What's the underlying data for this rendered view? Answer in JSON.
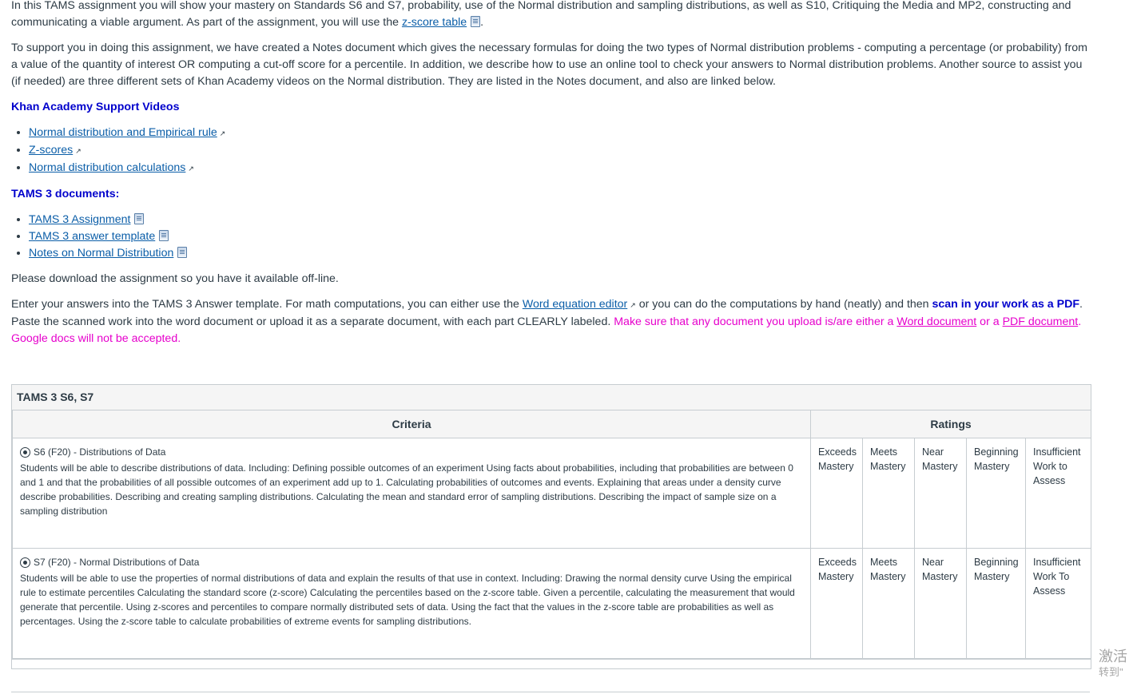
{
  "intro": {
    "p1_pre": "In this TAMS assignment you will show your mastery on Standards S6 and S7, probability, use of the Normal distribution and sampling distributions, as well as S10, Critiquing the Media and MP2, constructing and communicating a viable argument. As part of the assignment, you will use the ",
    "p1_link": "z-score table",
    "p1_post": ".",
    "p2": "To support you in doing this assignment, we have created a Notes document which gives the necessary formulas for doing the two types of Normal distribution problems - computing a percentage (or probability) from a value of the quantity of interest OR computing a cut-off score for a percentile. In addition, we describe how to use an online tool to check your answers to Normal distribution problems. Another source to assist you (if needed) are three different sets of Khan Academy videos on the Normal distribution. They are listed in the Notes document, and also are linked below."
  },
  "khan": {
    "heading": "Khan Academy Support Videos",
    "items": [
      "Normal distribution and Empirical rule",
      "Z-scores",
      "Normal distribution calculations"
    ]
  },
  "tams": {
    "heading": "TAMS 3 documents:",
    "items": [
      "TAMS 3 Assignment",
      "TAMS 3 answer template",
      "Notes on Normal Distribution"
    ]
  },
  "download_note": "Please download the assignment so you have it available off-line.",
  "answers": {
    "pre": "Enter your answers into the TAMS 3 Answer template. For math computations, you can either use the ",
    "editor_link": "Word equation editor",
    "mid": " or you can do the computations by hand (neatly) and then ",
    "scan": "scan in your work as a PDF",
    "post": ". Paste the scanned work  into the word document or upload it as a separate document, with each part CLEARLY labeled. ",
    "warn_pre": "Make sure that any document you upload is/are either a ",
    "word_link": "Word document",
    "warn_mid": " or a ",
    "pdf_link": "PDF document",
    "warn_post": ". Google docs will not be accepted."
  },
  "rubric": {
    "title": "TAMS 3 S6, S7",
    "col_criteria": "Criteria",
    "col_ratings": "Ratings",
    "rows": [
      {
        "title": "S6 (F20) - Distributions of Data",
        "desc": "Students will be able to describe distributions of data. Including: Defining possible outcomes of an experiment Using facts about probabilities, including that probabilities are between 0 and 1 and that the probabilities of all possible outcomes of an experiment add up to 1. Calculating probabilities of outcomes and events. Explaining that areas under a density curve describe probabilities. Describing and creating sampling distributions. Calculating the mean and standard error of sampling distributions. Describing the impact of sample size on a sampling distribution",
        "ratings": [
          "Exceeds Mastery",
          "Meets Mastery",
          "Near Mastery",
          "Beginning Mastery",
          "Insufficient Work to Assess"
        ]
      },
      {
        "title": "S7 (F20) - Normal Distributions of Data",
        "desc": "Students will be able to use the properties of normal distributions of data and explain the results of that use in context.  Including: Drawing the normal density curve Using the empirical rule to estimate percentiles Calculating the standard score (z-score) Calculating the percentiles based on the z-score table. Given a percentile, calculating the measurement that would generate that percentile. Using z-scores and percentiles to compare normally distributed sets of data. Using the fact that the values in the z-score table are probabilities as well as percentages.  Using the z-score table to calculate probabilities of extreme events for sampling distributions.",
        "ratings": [
          "Exceeds Mastery",
          "Meets Mastery",
          "Near Mastery",
          "Beginning Mastery",
          "Insufficient Work To Assess"
        ]
      }
    ]
  },
  "watermark": {
    "line1": "激活",
    "line2": "转到\""
  }
}
